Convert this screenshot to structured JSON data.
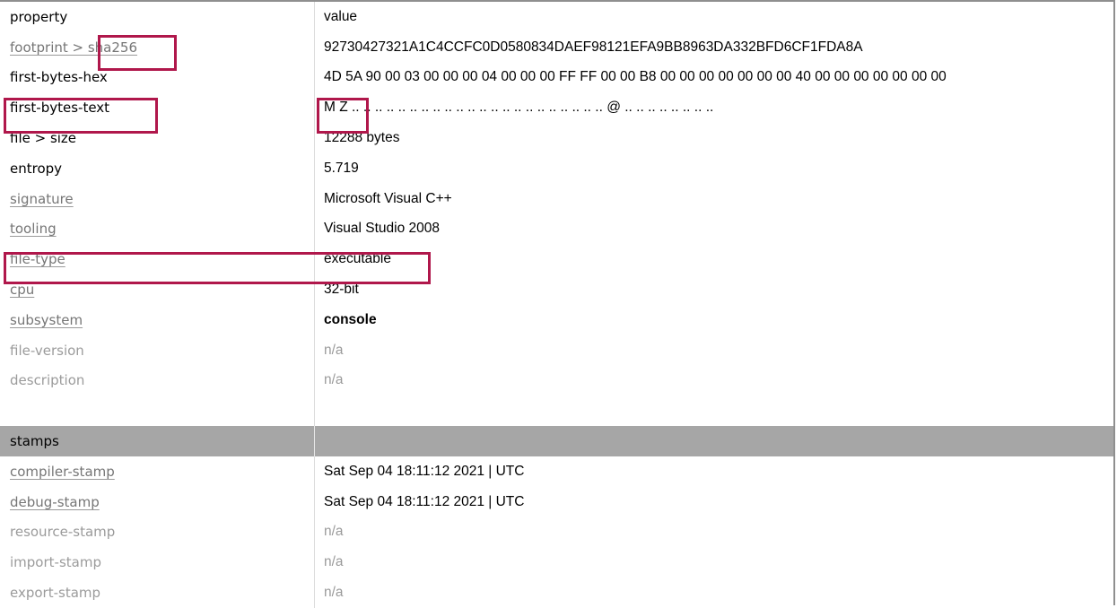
{
  "header": {
    "property": "property",
    "value": "value"
  },
  "rows": [
    {
      "label": "footprint > sha256",
      "value": "92730427321A1C4CCFC0D0580834DAEF98121EFA9BB8963DA332BFD6CF1FDA8A"
    },
    {
      "label": "first-bytes-hex",
      "value": "4D 5A 90 00 03 00 00 00 04 00 00 00 FF FF 00 00 B8 00 00 00 00 00 00 00 40 00 00 00 00 00 00 00"
    },
    {
      "label": "first-bytes-text",
      "value": "M Z .. .. .. .. .. .. .. .. .. .. .. .. .. .. .. .. .. .. .. .. .. .. @ .. .. .. .. .. .. .. .."
    },
    {
      "label": "file > size",
      "value": "12288 bytes"
    },
    {
      "label": "entropy",
      "value": "5.719"
    },
    {
      "label": "signature",
      "value": "Microsoft Visual C++"
    },
    {
      "label": "tooling",
      "value": "Visual Studio 2008"
    },
    {
      "label": "file-type",
      "value": "executable"
    },
    {
      "label": "cpu",
      "value": "32-bit"
    },
    {
      "label": "subsystem",
      "value": "console"
    },
    {
      "label": "file-version",
      "value": "n/a"
    },
    {
      "label": "description",
      "value": "n/a"
    },
    {
      "label": "",
      "value": ""
    }
  ],
  "stamps": {
    "title": "stamps",
    "rows": [
      {
        "label": "compiler-stamp",
        "value": "Sat Sep 04 18:11:12 2021 | UTC"
      },
      {
        "label": "debug-stamp",
        "value": "Sat Sep 04 18:11:12 2021 | UTC"
      },
      {
        "label": "resource-stamp",
        "value": "n/a"
      },
      {
        "label": "import-stamp",
        "value": "n/a"
      },
      {
        "label": "export-stamp",
        "value": "n/a"
      }
    ]
  },
  "highlight_color": "#b0174b",
  "section_color": "#a6a6a6"
}
